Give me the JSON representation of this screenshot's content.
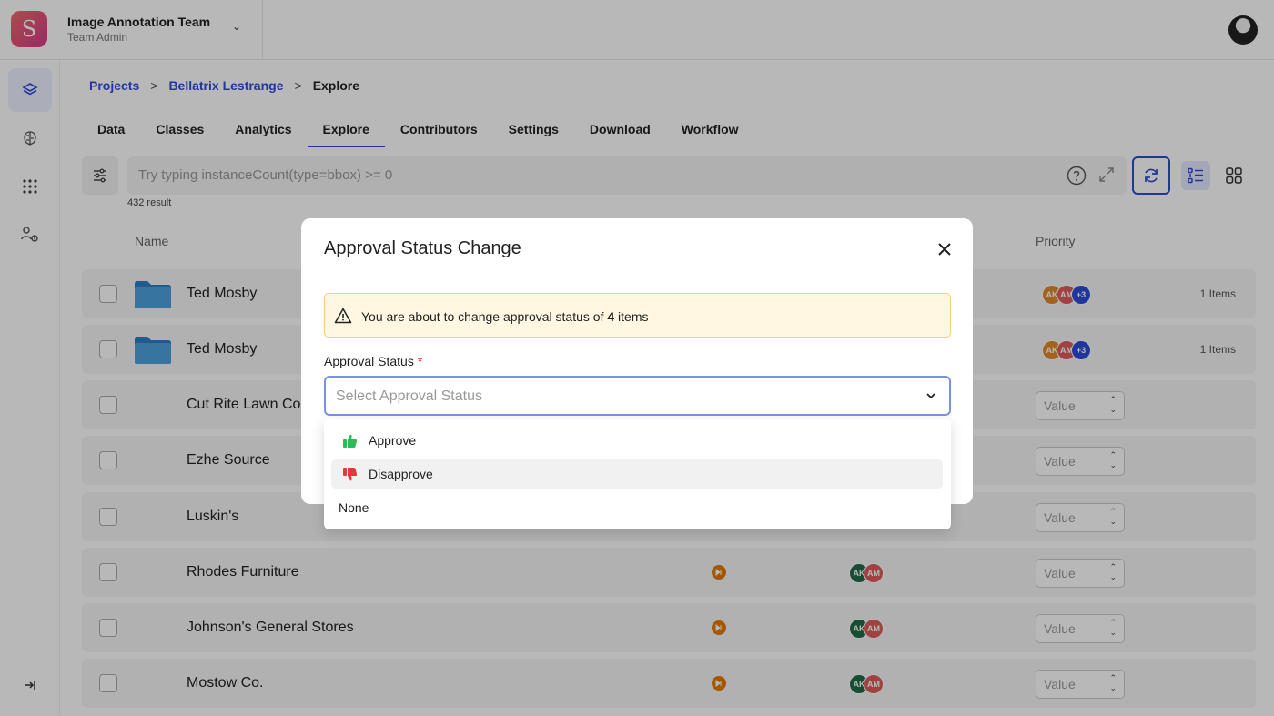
{
  "team": {
    "name": "Image Annotation Team",
    "role": "Team Admin",
    "logo_letter": "S"
  },
  "breadcrumb": {
    "projects": "Projects",
    "project": "Bellatrix Lestrange",
    "current": "Explore",
    "separator": ">"
  },
  "tabs": [
    "Data",
    "Classes",
    "Analytics",
    "Explore",
    "Contributors",
    "Settings",
    "Download",
    "Workflow"
  ],
  "active_tab": "Explore",
  "search": {
    "placeholder": "Try typing instanceCount(type=bbox) >= 0"
  },
  "result_count": "432 result",
  "table": {
    "headers": {
      "name": "Name",
      "priority": "Priority"
    },
    "rows": [
      {
        "name": "Ted Mosby",
        "folder": true,
        "avatars": [
          "AK",
          "AM",
          "+3"
        ],
        "items": "1 Items"
      },
      {
        "name": "Ted Mosby",
        "folder": true,
        "avatars": [
          "AK",
          "AM",
          "+3"
        ],
        "items": "1 Items"
      },
      {
        "name": "Cut Rite Lawn Co",
        "priority": "Value"
      },
      {
        "name": "Ezhe Source",
        "priority": "Value"
      },
      {
        "name": "Luskin's",
        "priority": "Value"
      },
      {
        "name": "Rhodes Furniture",
        "avatars": [
          "AK",
          "AM"
        ],
        "priority": "Value"
      },
      {
        "name": "Johnson's General Stores",
        "avatars": [
          "AK",
          "AM"
        ],
        "priority": "Value"
      },
      {
        "name": "Mostow Co.",
        "avatars": [
          "AK",
          "AM"
        ],
        "priority": "Value"
      }
    ]
  },
  "modal": {
    "title": "Approval Status Change",
    "warning_prefix": "You are about to change approval status of ",
    "warning_count": "4",
    "warning_suffix": " items",
    "field_label": "Approval Status",
    "required_mark": "*",
    "select_placeholder": "Select Approval  Status",
    "options": [
      "Approve",
      "Disapprove",
      "None"
    ]
  },
  "colors": {
    "accent": "#2f4bd8",
    "approve": "#2dbb5a",
    "disapprove": "#e03a3a",
    "status_orange": "#e07b00",
    "avatar_ak_orange": "#e08a2a",
    "avatar_am": "#e05a5a",
    "avatar_more": "#2f4bd8",
    "avatar_ak_green": "#1f6b4a"
  }
}
